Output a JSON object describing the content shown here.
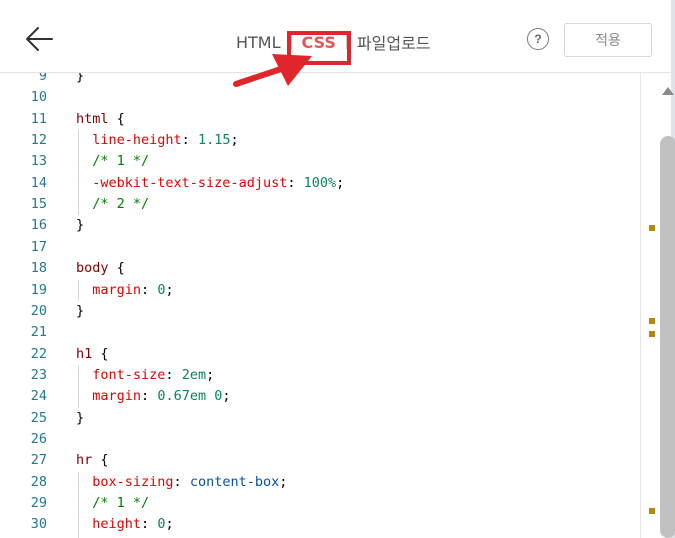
{
  "header": {
    "tabs": [
      {
        "label": "HTML",
        "active": false
      },
      {
        "label": "CSS",
        "active": true
      },
      {
        "label": "파일업로드",
        "active": false
      }
    ],
    "help_label": "?",
    "apply_label": "적용"
  },
  "colors": {
    "active_tab": "#e0565b",
    "annotation_red": "#e0262b",
    "line_number": "#237893",
    "selector": "#800000",
    "property": "#e50000",
    "number": "#098658",
    "value": "#0451a5",
    "comment": "#008000"
  },
  "icons": {
    "back": "arrow-left-icon",
    "help": "question-circle-icon",
    "scroll_up": "triangle-up-icon"
  },
  "editor": {
    "lines": [
      {
        "num": "9",
        "code": "}"
      },
      {
        "num": "10",
        "code": ""
      },
      {
        "num": "11",
        "code": "html {"
      },
      {
        "num": "12",
        "code": "  line-height: 1.15;"
      },
      {
        "num": "13",
        "code": "  /* 1 */"
      },
      {
        "num": "14",
        "code": "  -webkit-text-size-adjust: 100%;"
      },
      {
        "num": "15",
        "code": "  /* 2 */"
      },
      {
        "num": "16",
        "code": "}"
      },
      {
        "num": "17",
        "code": ""
      },
      {
        "num": "18",
        "code": "body {"
      },
      {
        "num": "19",
        "code": "  margin: 0;"
      },
      {
        "num": "20",
        "code": "}"
      },
      {
        "num": "21",
        "code": ""
      },
      {
        "num": "22",
        "code": "h1 {"
      },
      {
        "num": "23",
        "code": "  font-size: 2em;"
      },
      {
        "num": "24",
        "code": "  margin: 0.67em 0;"
      },
      {
        "num": "25",
        "code": "}"
      },
      {
        "num": "26",
        "code": ""
      },
      {
        "num": "27",
        "code": "hr {"
      },
      {
        "num": "28",
        "code": "  box-sizing: content-box;"
      },
      {
        "num": "29",
        "code": "  /* 1 */"
      },
      {
        "num": "30",
        "code": "  height: 0;"
      }
    ]
  }
}
